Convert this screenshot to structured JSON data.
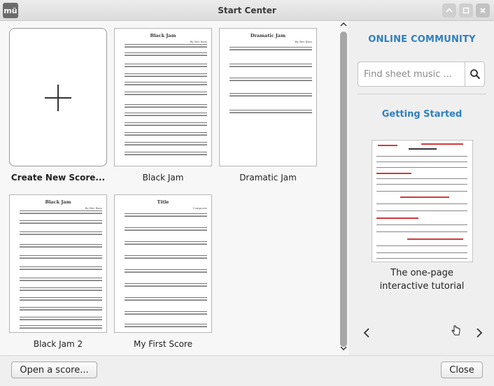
{
  "window": {
    "title": "Start Center",
    "app_icon_text": "mü"
  },
  "scores": [
    {
      "label": "Create New Score...",
      "type": "new"
    },
    {
      "label": "Black Jam",
      "sheet_title": "Black Jam",
      "composer": "By Bes Bass"
    },
    {
      "label": "Dramatic Jam",
      "sheet_title": "Dramatic Jam",
      "composer": "By Bes Bass"
    },
    {
      "label": "Black Jam 2",
      "sheet_title": "Black Jam",
      "composer": "By Bes Bass"
    },
    {
      "label": "My First Score",
      "sheet_title": "Title",
      "composer": "Composer"
    }
  ],
  "panel": {
    "heading": "ONLINE COMMUNITY",
    "search_placeholder": "Find sheet music ...",
    "getting_started": "Getting Started",
    "tutorial_line1": "The one-page",
    "tutorial_line2": "interactive tutorial"
  },
  "footer": {
    "open_label": "Open a score...",
    "close_label": "Close"
  },
  "colors": {
    "accent": "#2f7fc0"
  }
}
